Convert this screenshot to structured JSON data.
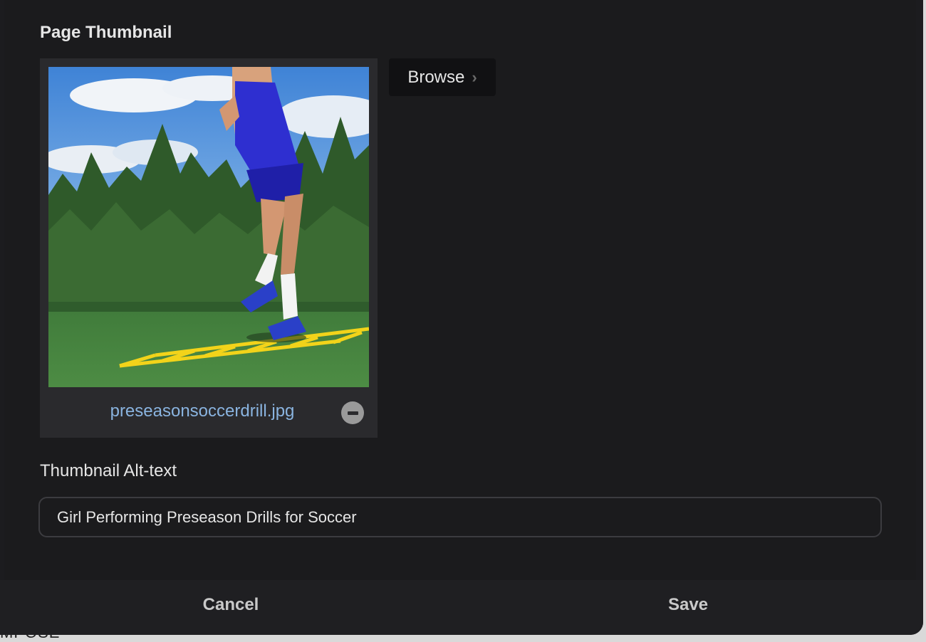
{
  "thumbnail_section": {
    "title": "Page Thumbnail",
    "file_name": "preseasonsoccerdrill.jpg",
    "browse_label": "Browse",
    "browse_chevron": "›"
  },
  "alt_text": {
    "label": "Thumbnail Alt-text",
    "value": "Girl Performing Preseason Drills for Soccer"
  },
  "footer": {
    "cancel_label": "Cancel",
    "save_label": "Save"
  },
  "colors": {
    "modal_bg": "#1c1c1f",
    "card_bg": "#2a2a2d",
    "link": "#8ab4e0",
    "text": "#e6e6e6"
  }
}
